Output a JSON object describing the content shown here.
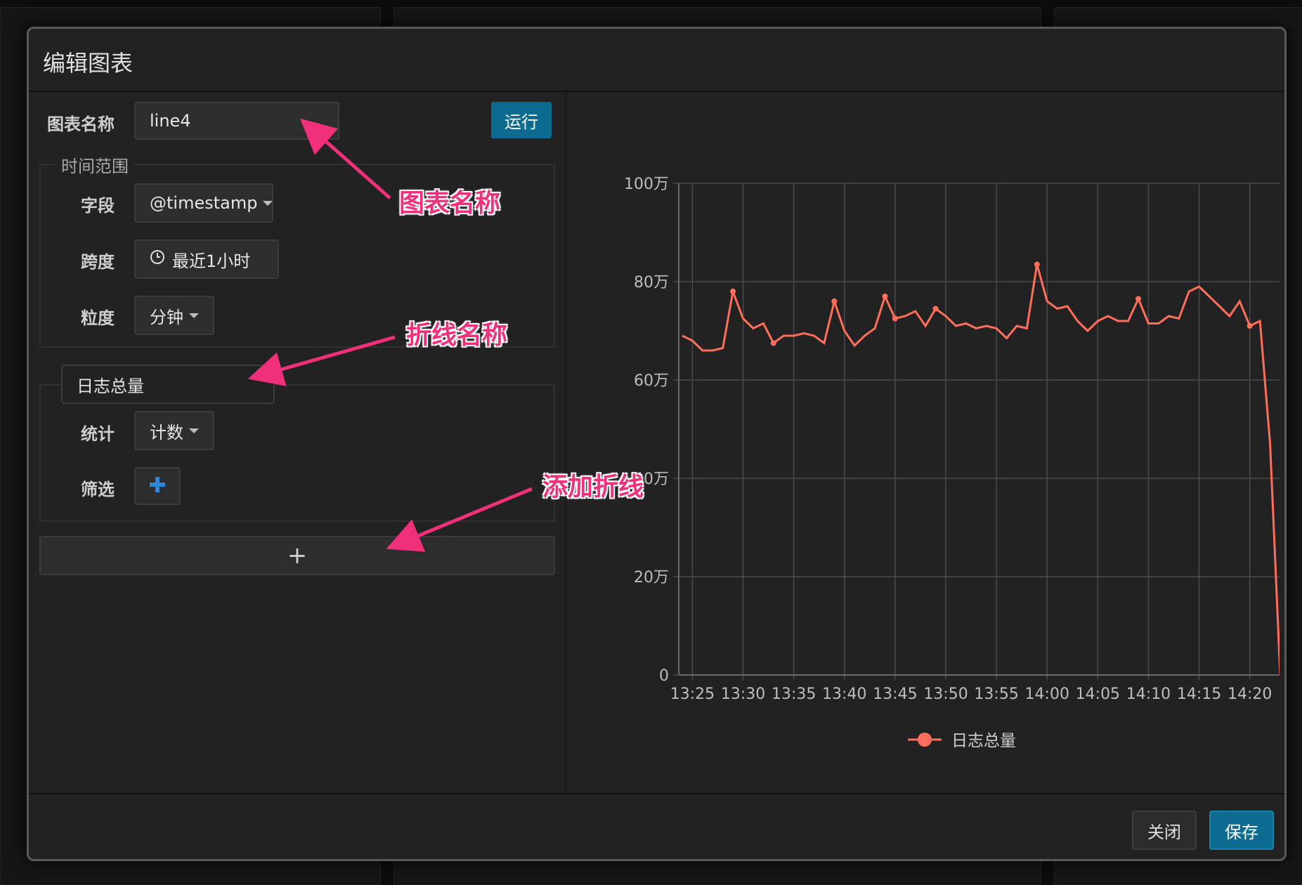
{
  "modal": {
    "title": "编辑图表",
    "chart_name_label": "图表名称",
    "chart_name_value": "line4",
    "run_button": "运行",
    "time_range": {
      "legend": "时间范围",
      "field_label": "字段",
      "field_value": "@timestamp",
      "span_label": "跨度",
      "span_value": "最近1小时",
      "granularity_label": "粒度",
      "granularity_value": "分钟"
    },
    "series": {
      "name_value": "日志总量",
      "stat_label": "统计",
      "stat_value": "计数",
      "filter_label": "筛选"
    },
    "add_line_symbol": "+",
    "close_button": "关闭",
    "save_button": "保存"
  },
  "annotations": {
    "chart_name": "图表名称",
    "line_name": "折线名称",
    "add_line": "添加折线"
  },
  "colors": {
    "accent": "#0d6b91",
    "line": "#ff6e5a",
    "annotation": "#f0307a"
  },
  "chart_data": {
    "type": "line",
    "x": [
      "13:24",
      "13:25",
      "13:26",
      "13:27",
      "13:28",
      "13:29",
      "13:30",
      "13:31",
      "13:32",
      "13:33",
      "13:34",
      "13:35",
      "13:36",
      "13:37",
      "13:38",
      "13:39",
      "13:40",
      "13:41",
      "13:42",
      "13:43",
      "13:44",
      "13:45",
      "13:46",
      "13:47",
      "13:48",
      "13:49",
      "13:50",
      "13:51",
      "13:52",
      "13:53",
      "13:54",
      "13:55",
      "13:56",
      "13:57",
      "13:58",
      "13:59",
      "14:00",
      "14:01",
      "14:02",
      "14:03",
      "14:04",
      "14:05",
      "14:06",
      "14:07",
      "14:08",
      "14:09",
      "14:10",
      "14:11",
      "14:12",
      "14:13",
      "14:14",
      "14:15",
      "14:16",
      "14:17",
      "14:18",
      "14:19",
      "14:20",
      "14:21",
      "14:22",
      "14:23"
    ],
    "x_ticks": [
      "13:25",
      "13:30",
      "13:35",
      "13:40",
      "13:45",
      "13:50",
      "13:55",
      "14:00",
      "14:05",
      "14:10",
      "14:15",
      "14:20"
    ],
    "series": [
      {
        "name": "日志总量",
        "values": [
          690000,
          680000,
          660000,
          660000,
          665000,
          780000,
          725000,
          705000,
          715000,
          675000,
          690000,
          690000,
          695000,
          690000,
          675000,
          760000,
          700000,
          670000,
          690000,
          705000,
          770000,
          725000,
          730000,
          740000,
          710000,
          745000,
          730000,
          710000,
          715000,
          705000,
          710000,
          705000,
          685000,
          710000,
          705000,
          835000,
          760000,
          745000,
          750000,
          720000,
          700000,
          720000,
          730000,
          720000,
          720000,
          765000,
          715000,
          715000,
          730000,
          725000,
          780000,
          790000,
          770000,
          750000,
          730000,
          760000,
          710000,
          720000,
          470000,
          0
        ]
      }
    ],
    "y_ticks": [
      "0",
      "20万",
      "40万",
      "60万",
      "80万",
      "100万"
    ],
    "ylim": [
      0,
      1000000
    ],
    "grid": true,
    "legend": "bottom-center"
  }
}
